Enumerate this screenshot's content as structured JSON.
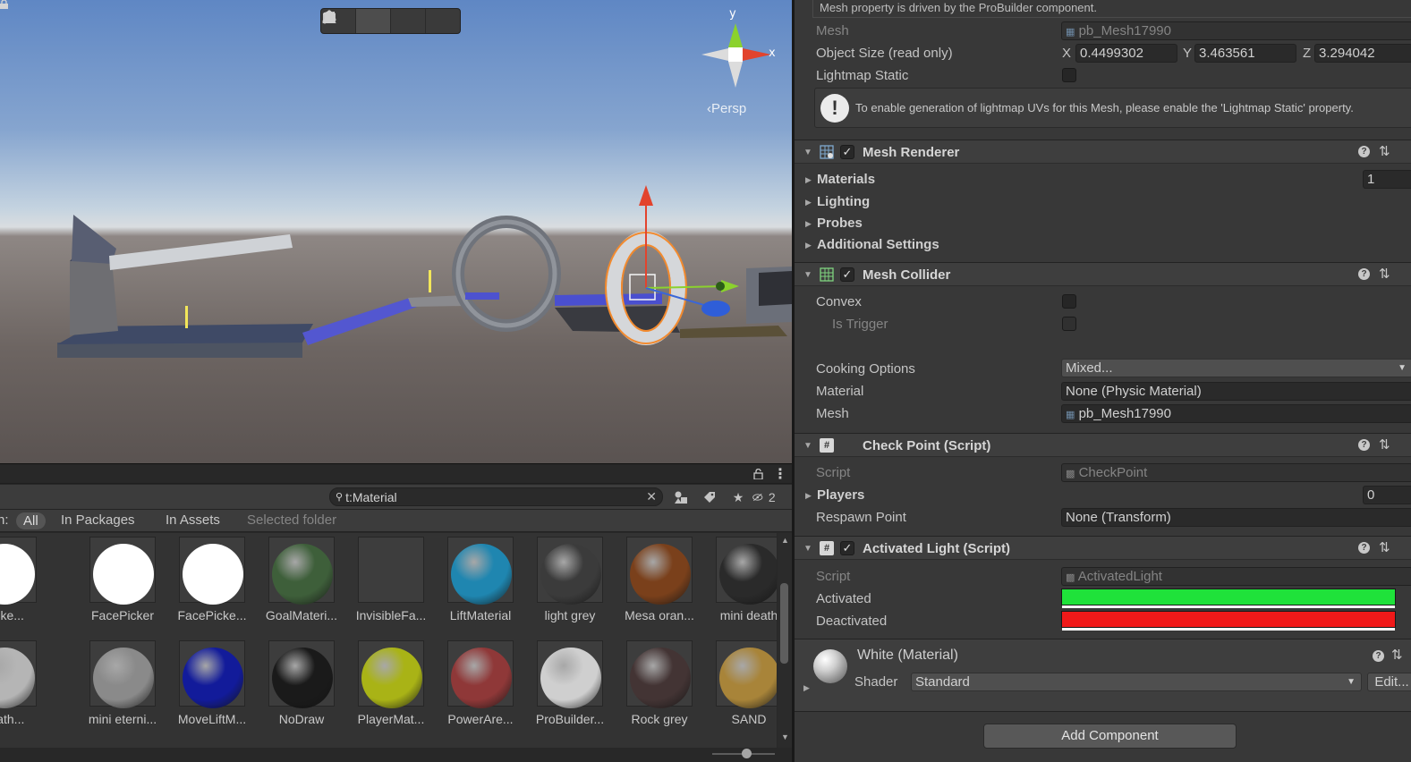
{
  "scene": {
    "gizmo": {
      "y": "y",
      "x": "x"
    },
    "projection": "Persp"
  },
  "project": {
    "search_text": "t:Material",
    "filter_hidden_count": "2",
    "scope": {
      "prefix": "n:",
      "all": "All",
      "in_packages": "In Packages",
      "in_assets": "In Assets",
      "selected_folder": "Selected folder"
    },
    "assets_row1": [
      {
        "label": "Picke...",
        "color": "#ffffff"
      },
      {
        "label": "FacePicker",
        "color": "#ffffff"
      },
      {
        "label": "FacePicke...",
        "color": "#ffffff"
      },
      {
        "label": "GoalMateri...",
        "color": "#3e5f3a"
      },
      {
        "label": "InvisibleFa...",
        "color": "#555555"
      },
      {
        "label": "LiftMaterial",
        "color": "#1f86b0"
      },
      {
        "label": "light grey",
        "color": "#3b3b3b"
      },
      {
        "label": "Mesa oran...",
        "color": "#7a401b"
      },
      {
        "label": "mini death",
        "color": "#2a2a2a"
      }
    ],
    "assets_row2": [
      {
        "label": "death...",
        "color": "#b5b5b5"
      },
      {
        "label": "mini eterni...",
        "color": "#8a8a8a"
      },
      {
        "label": "MoveLiftM...",
        "color": "#121b9a"
      },
      {
        "label": "NoDraw",
        "color": "#1a1a1a"
      },
      {
        "label": "PlayerMat...",
        "color": "#a9b316"
      },
      {
        "label": "PowerAre...",
        "color": "#8f3838"
      },
      {
        "label": "ProBuilder...",
        "color": "#cfcfcf"
      },
      {
        "label": "Rock grey",
        "color": "#433434"
      },
      {
        "label": "SAND",
        "color": "#a88439"
      }
    ]
  },
  "inspector": {
    "driven_note": "Mesh property is driven by the ProBuilder component.",
    "mesh_filter": {
      "mesh_label": "Mesh",
      "mesh_value": "pb_Mesh17990",
      "object_size_label": "Object Size (read only)",
      "x_label": "X",
      "x_value": "0.4499302",
      "y_label": "Y",
      "y_value": "3.463561",
      "z_label": "Z",
      "z_value": "3.294042",
      "lightmap_static_label": "Lightmap Static",
      "lightmap_help": "To enable generation of lightmap UVs for this Mesh, please enable the 'Lightmap Static' property."
    },
    "mesh_renderer": {
      "title": "Mesh Renderer",
      "materials_label": "Materials",
      "materials_count": "1",
      "lighting_label": "Lighting",
      "probes_label": "Probes",
      "additional_label": "Additional Settings"
    },
    "mesh_collider": {
      "title": "Mesh Collider",
      "convex_label": "Convex",
      "is_trigger_label": "Is Trigger",
      "cooking_label": "Cooking Options",
      "cooking_value": "Mixed...",
      "material_label": "Material",
      "material_value": "None (Physic Material)",
      "mesh_label": "Mesh",
      "mesh_value": "pb_Mesh17990"
    },
    "check_point": {
      "title": "Check Point (Script)",
      "script_label": "Script",
      "script_value": "CheckPoint",
      "players_label": "Players",
      "players_count": "0",
      "respawn_label": "Respawn Point",
      "respawn_value": "None (Transform)"
    },
    "activated_light": {
      "title": "Activated Light (Script)",
      "script_label": "Script",
      "script_value": "ActivatedLight",
      "activated_label": "Activated",
      "activated_color": "#1fe23a",
      "deactivated_label": "Deactivated",
      "deactivated_color": "#f01919"
    },
    "material": {
      "name": "White (Material)",
      "shader_label": "Shader",
      "shader_value": "Standard",
      "edit_label": "Edit..."
    },
    "add_component": "Add Component"
  }
}
